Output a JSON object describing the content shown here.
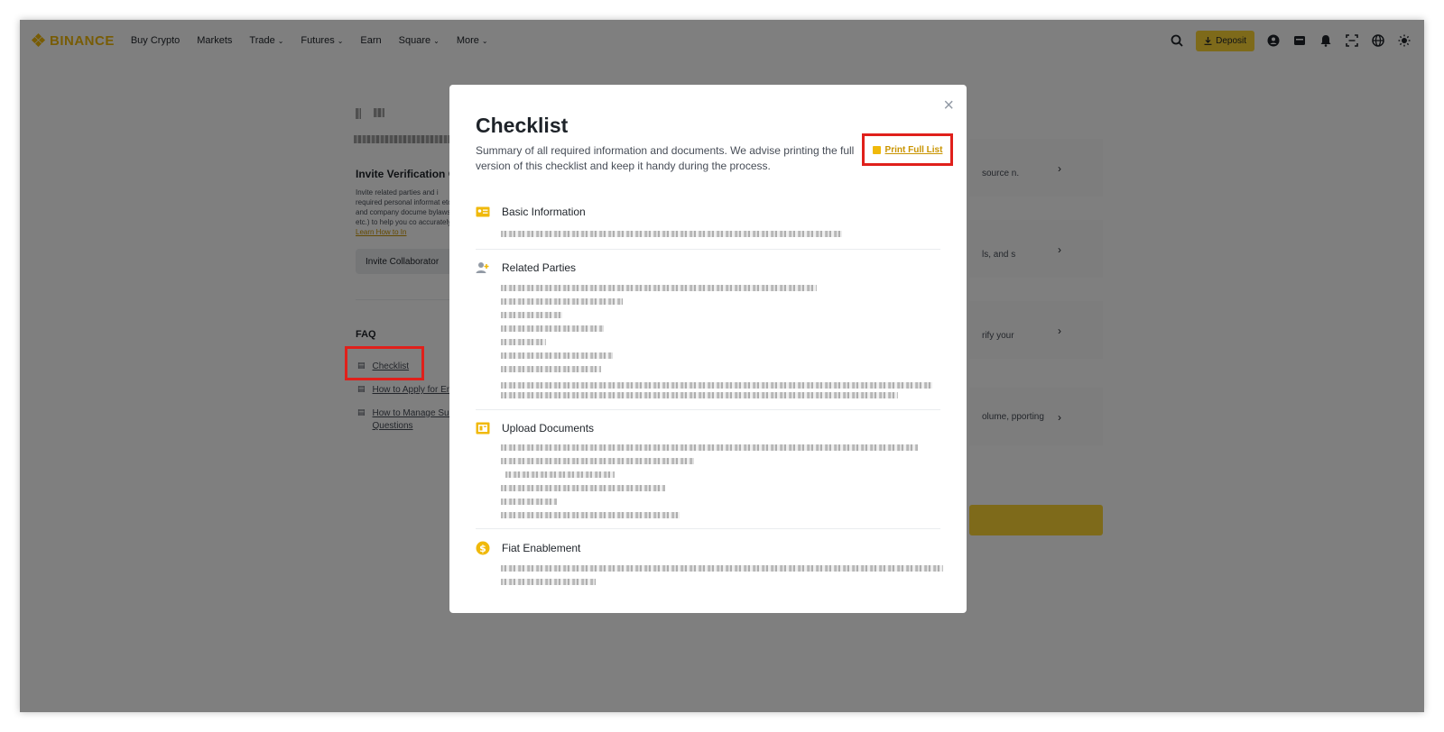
{
  "nav": {
    "logo": "BINANCE",
    "items": [
      {
        "label": "Buy Crypto",
        "dropdown": false
      },
      {
        "label": "Markets",
        "dropdown": false
      },
      {
        "label": "Trade",
        "dropdown": true
      },
      {
        "label": "Futures",
        "dropdown": true
      },
      {
        "label": "Earn",
        "dropdown": false
      },
      {
        "label": "Square",
        "dropdown": true
      },
      {
        "label": "More",
        "dropdown": true
      }
    ],
    "deposit_label": "Deposit",
    "chevron": "⌄",
    "icons": [
      "search-icon",
      "download-icon",
      "user-icon",
      "wallet-icon",
      "bell-icon",
      "scan-icon",
      "globe-icon",
      "theme-icon"
    ]
  },
  "background": {
    "invite_title": "Invite Verification C",
    "invite_desc": "Invite related parties and i required personal informat etc.) and company docume bylaws, etc.) to help you co accurately.",
    "invite_link": "Learn How to In",
    "invite_button": "Invite Collaborator",
    "faq_title": "FAQ",
    "faq_items": [
      "Checklist",
      "How to Apply for En",
      "How to Manage Sub",
      "Questions"
    ],
    "right_cards": [
      "source n.",
      "ls, and s",
      "rify your",
      "olume, pporting"
    ]
  },
  "modal": {
    "title": "Checklist",
    "subtitle": "Summary of all required information and documents. We advise printing the full version of this checklist and keep it handy during the process.",
    "print_label": "Print Full List",
    "close_glyph": "×",
    "sections": [
      {
        "title": "Basic Information",
        "icon": "id-card-icon"
      },
      {
        "title": "Related Parties",
        "icon": "add-person-icon"
      },
      {
        "title": "Upload Documents",
        "icon": "document-upload-icon"
      },
      {
        "title": "Fiat Enablement",
        "icon": "dollar-coin-icon"
      }
    ]
  },
  "colors": {
    "brand": "#F0B90B",
    "deposit_bg": "#FCD535",
    "highlight": "#E0201B",
    "link": "#C99400"
  }
}
